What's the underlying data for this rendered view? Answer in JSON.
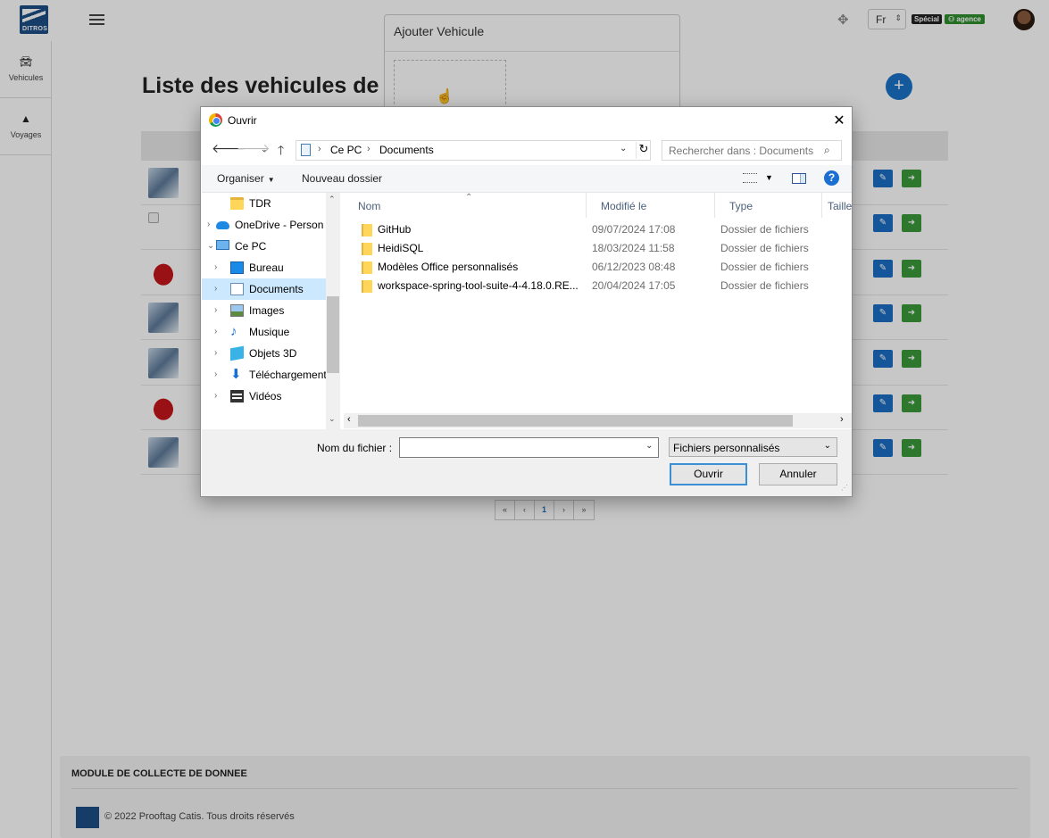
{
  "app": {
    "logo_text": "DITROS",
    "language": "Fr",
    "badge_special": "Spécial",
    "badge_agence": "agence",
    "sidebar": [
      {
        "label": "Vehicules",
        "icon": "car-icon"
      },
      {
        "label": "Voyages",
        "icon": "road-icon"
      }
    ],
    "page_title": "Liste des vehicules de",
    "add_button": "+",
    "pagination": [
      "«",
      "‹",
      "1",
      "›",
      "»"
    ],
    "footer_title": "MODULE DE COLLECTE DE DONNEE",
    "footer_copyright": "© 2022 Prooftag Catis. Tous droits réservés"
  },
  "ajout_modal": {
    "title": "Ajouter Vehicule"
  },
  "dialog": {
    "title": "Ouvrir",
    "address": [
      "Ce PC",
      "Documents"
    ],
    "search_placeholder": "Rechercher dans : Documents",
    "toolbar": {
      "organize": "Organiser",
      "new_folder": "Nouveau dossier"
    },
    "tree": [
      {
        "label": "TDR",
        "icon": "folder-icon",
        "indent": 2,
        "expander": false,
        "selected": false
      },
      {
        "label": "OneDrive - Person",
        "icon": "cloud-icon",
        "indent": 1,
        "expander": true,
        "selected": false
      },
      {
        "label": "Ce PC",
        "icon": "pc-icon",
        "indent": 1,
        "expander": true,
        "expanded": true,
        "selected": false
      },
      {
        "label": "Bureau",
        "icon": "desktop-icon",
        "indent": 2,
        "expander": true,
        "selected": false
      },
      {
        "label": "Documents",
        "icon": "documents-icon",
        "indent": 2,
        "expander": true,
        "selected": true
      },
      {
        "label": "Images",
        "icon": "images-icon",
        "indent": 2,
        "expander": true,
        "selected": false
      },
      {
        "label": "Musique",
        "icon": "music-icon",
        "indent": 2,
        "expander": true,
        "selected": false
      },
      {
        "label": "Objets 3D",
        "icon": "3d-objects-icon",
        "indent": 2,
        "expander": true,
        "selected": false
      },
      {
        "label": "Téléchargements",
        "icon": "downloads-icon",
        "indent": 2,
        "expander": true,
        "selected": false
      },
      {
        "label": "Vidéos",
        "icon": "videos-icon",
        "indent": 2,
        "expander": true,
        "selected": false
      }
    ],
    "columns": [
      "Nom",
      "Modifié le",
      "Type",
      "Taille"
    ],
    "files": [
      {
        "name": "GitHub",
        "modified": "09/07/2024 17:08",
        "type": "Dossier de fichiers"
      },
      {
        "name": "HeidiSQL",
        "modified": "18/03/2024 11:58",
        "type": "Dossier de fichiers"
      },
      {
        "name": "Modèles Office personnalisés",
        "modified": "06/12/2023 08:48",
        "type": "Dossier de fichiers"
      },
      {
        "name": "workspace-spring-tool-suite-4-4.18.0.RE...",
        "modified": "20/04/2024 17:05",
        "type": "Dossier de fichiers"
      }
    ],
    "filename_label": "Nom du fichier :",
    "filename_value": "",
    "filetype": "Fichiers personnalisés",
    "open_button": "Ouvrir",
    "cancel_button": "Annuler"
  }
}
